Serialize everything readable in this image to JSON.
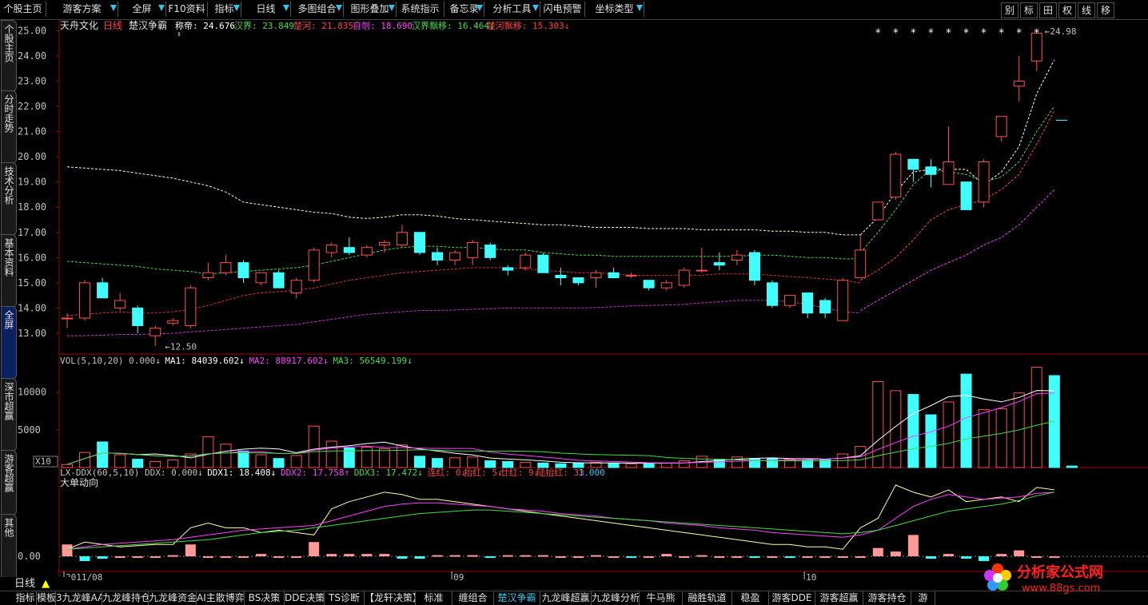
{
  "toolbar": {
    "items": [
      {
        "label": "个股主页",
        "dd": false
      },
      {
        "label": "游客方案",
        "dd": true
      },
      {
        "label": "全屏",
        "dd": true
      },
      {
        "label": "F10资料",
        "dd": false
      },
      {
        "label": "指标",
        "dd": true
      },
      {
        "label": "日线",
        "dd": true
      },
      {
        "label": "多图组合",
        "dd": true
      },
      {
        "label": "图形叠加",
        "dd": true
      },
      {
        "label": "系统指示",
        "dd": false
      },
      {
        "label": "备忘录",
        "dd": true
      },
      {
        "label": "分析工具",
        "dd": true
      },
      {
        "label": "闪电预警",
        "dd": false
      },
      {
        "label": "坐标类型",
        "dd": true
      }
    ],
    "right_buttons": [
      "别",
      "标",
      "田",
      "权",
      "线",
      "移"
    ],
    "logo_text": "分析家公式网"
  },
  "sidebar": {
    "tabs": [
      "个股主页",
      "分时走势",
      "技术分析",
      "基本资料",
      "全屏",
      "深市超赢",
      "游客超赢",
      "其他"
    ]
  },
  "main_chart": {
    "title_stock": "天舟文化",
    "title_period": "日线",
    "indicator_name": "楚汉争霸",
    "legend": [
      {
        "label": "称帝: 24.676",
        "color": "#ffffff"
      },
      {
        "label": "汉界: 23.849",
        "color": "#44dd44"
      },
      {
        "label": "楚河: 21.835",
        "color": "#ff4040"
      },
      {
        "label": "自刎: 18.690",
        "color": "#ff40ff"
      },
      {
        "label": "汉界飘移: 16.464↓",
        "color": "#44dd44"
      },
      {
        "label": "楚河飘移: 15.303↓",
        "color": "#ff4040"
      }
    ],
    "y_ticks": [
      "25.00",
      "24.00",
      "23.00",
      "22.00",
      "21.00",
      "20.00",
      "19.00",
      "18.00",
      "17.00",
      "16.00",
      "15.00",
      "14.00",
      "13.00"
    ],
    "low_label": "12.50",
    "high_label": "24.98"
  },
  "vol_chart": {
    "legend": [
      {
        "label": "VOL(5,10,20) 0.000↓",
        "color": "#c0c0c0"
      },
      {
        "label": "MA1: 84039.602↓",
        "color": "#ffffff"
      },
      {
        "label": "MA2: 88917.602↓",
        "color": "#ff40ff"
      },
      {
        "label": "MA3: 56549.199↓",
        "color": "#44dd44"
      }
    ],
    "y_ticks": [
      "10000",
      "5000"
    ],
    "multiplier": "X10"
  },
  "ddx_chart": {
    "legend": [
      {
        "label": "LX-DDX(60,5,10) DDX: 0.000↓",
        "color": "#c0c0c0"
      },
      {
        "label": "DDX1: 18.408↓",
        "color": "#ffffff"
      },
      {
        "label": "DDX2: 17.758↑",
        "color": "#ff40ff"
      },
      {
        "label": "DDX3: 17.472↓",
        "color": "#44dd44"
      },
      {
        "label": "连红: 0↓",
        "color": "#ff4040"
      },
      {
        "label": "抬红: 5↓",
        "color": "#ff4040"
      },
      {
        "label": "廿红: 9↓",
        "color": "#ff4040"
      },
      {
        "label": "陆抬红: 33",
        "color": "#ff4040"
      },
      {
        "label": "1.000",
        "color": "#37c0e8"
      }
    ],
    "subtitle": "大单动向",
    "y_tick": "0.00"
  },
  "x_axis": {
    "labels": [
      {
        "text": "2011/08",
        "i": 0
      },
      {
        "text": "09",
        "i": 22
      },
      {
        "text": "10",
        "i": 42
      }
    ]
  },
  "period_label": "日线",
  "bottom_tabs": [
    "指标",
    "模板",
    "3九龙峰AAX",
    "九龙峰持仓",
    "九龙峰资金",
    "AI主散博弈",
    "BS决策",
    "DDE决策",
    "TS诊断",
    "【龙轩决策】",
    "标准",
    "缠组合",
    "楚汉争霸",
    "九龙峰超赢",
    "九龙峰分析",
    "牛马熊",
    "融胜轨道",
    "稳盈",
    "游客DDE",
    "游客超赢",
    "游客持仓",
    "游"
  ],
  "active_bottom_tab": "楚汉争霸",
  "brand": {
    "name": "分析家公式网",
    "url": "www.88gs.com"
  },
  "colors": {
    "up": "#ff5050",
    "down": "#40ffff",
    "grid": "#800000",
    "axis": "#a00000"
  },
  "chart_data": {
    "type": "candlestick",
    "candles": [
      {
        "o": 13.6,
        "h": 13.8,
        "l": 13.2,
        "c": 13.6
      },
      {
        "o": 13.6,
        "h": 15.1,
        "l": 13.5,
        "c": 15.0
      },
      {
        "o": 15.0,
        "h": 15.2,
        "l": 14.6,
        "c": 14.4
      },
      {
        "o": 14.0,
        "h": 14.6,
        "l": 13.9,
        "c": 14.3
      },
      {
        "o": 14.0,
        "h": 14.1,
        "l": 13.0,
        "c": 13.3
      },
      {
        "o": 12.9,
        "h": 13.3,
        "l": 12.5,
        "c": 13.2
      },
      {
        "o": 13.4,
        "h": 13.6,
        "l": 13.3,
        "c": 13.5
      },
      {
        "o": 13.3,
        "h": 14.9,
        "l": 13.2,
        "c": 14.8
      },
      {
        "o": 15.2,
        "h": 15.8,
        "l": 15.1,
        "c": 15.4
      },
      {
        "o": 15.4,
        "h": 16.1,
        "l": 15.3,
        "c": 15.8
      },
      {
        "o": 15.8,
        "h": 15.9,
        "l": 15.0,
        "c": 15.2
      },
      {
        "o": 15.0,
        "h": 15.4,
        "l": 14.9,
        "c": 15.4
      },
      {
        "o": 15.4,
        "h": 15.5,
        "l": 14.8,
        "c": 14.8
      },
      {
        "o": 14.6,
        "h": 15.2,
        "l": 14.4,
        "c": 15.1
      },
      {
        "o": 15.1,
        "h": 16.4,
        "l": 15.0,
        "c": 16.3
      },
      {
        "o": 16.2,
        "h": 16.6,
        "l": 16.0,
        "c": 16.5
      },
      {
        "o": 16.4,
        "h": 16.8,
        "l": 16.1,
        "c": 16.2
      },
      {
        "o": 16.1,
        "h": 16.5,
        "l": 16.0,
        "c": 16.4
      },
      {
        "o": 16.5,
        "h": 16.7,
        "l": 16.2,
        "c": 16.6
      },
      {
        "o": 16.5,
        "h": 17.3,
        "l": 16.4,
        "c": 17.0
      },
      {
        "o": 17.0,
        "h": 17.0,
        "l": 16.1,
        "c": 16.2
      },
      {
        "o": 16.2,
        "h": 16.4,
        "l": 15.7,
        "c": 15.9
      },
      {
        "o": 15.9,
        "h": 16.3,
        "l": 15.7,
        "c": 16.2
      },
      {
        "o": 16.0,
        "h": 16.7,
        "l": 15.7,
        "c": 16.6
      },
      {
        "o": 16.5,
        "h": 16.6,
        "l": 15.9,
        "c": 16.0
      },
      {
        "o": 15.6,
        "h": 15.7,
        "l": 15.3,
        "c": 15.5
      },
      {
        "o": 15.6,
        "h": 16.2,
        "l": 15.5,
        "c": 16.1
      },
      {
        "o": 16.1,
        "h": 16.2,
        "l": 15.4,
        "c": 15.4
      },
      {
        "o": 15.3,
        "h": 15.6,
        "l": 14.9,
        "c": 15.2
      },
      {
        "o": 15.2,
        "h": 15.2,
        "l": 14.9,
        "c": 15.0
      },
      {
        "o": 15.2,
        "h": 15.5,
        "l": 14.8,
        "c": 15.4
      },
      {
        "o": 15.4,
        "h": 15.6,
        "l": 15.2,
        "c": 15.2
      },
      {
        "o": 15.3,
        "h": 15.4,
        "l": 15.2,
        "c": 15.3
      },
      {
        "o": 15.1,
        "h": 15.1,
        "l": 14.7,
        "c": 14.8
      },
      {
        "o": 14.8,
        "h": 15.1,
        "l": 14.7,
        "c": 15.0
      },
      {
        "o": 14.9,
        "h": 15.6,
        "l": 14.8,
        "c": 15.5
      },
      {
        "o": 15.5,
        "h": 16.4,
        "l": 15.4,
        "c": 15.5
      },
      {
        "o": 15.8,
        "h": 16.2,
        "l": 15.5,
        "c": 15.7
      },
      {
        "o": 15.9,
        "h": 16.3,
        "l": 15.7,
        "c": 16.1
      },
      {
        "o": 16.2,
        "h": 16.3,
        "l": 14.9,
        "c": 15.1
      },
      {
        "o": 15.0,
        "h": 15.1,
        "l": 14.0,
        "c": 14.1
      },
      {
        "o": 14.1,
        "h": 14.5,
        "l": 14.0,
        "c": 14.5
      },
      {
        "o": 14.6,
        "h": 14.6,
        "l": 13.6,
        "c": 13.8
      },
      {
        "o": 14.3,
        "h": 14.4,
        "l": 13.6,
        "c": 13.8
      },
      {
        "o": 13.5,
        "h": 15.2,
        "l": 13.5,
        "c": 15.1
      },
      {
        "o": 15.2,
        "h": 16.9,
        "l": 15.2,
        "c": 16.3
      },
      {
        "o": 17.5,
        "h": 18.2,
        "l": 17.5,
        "c": 18.2
      },
      {
        "o": 18.4,
        "h": 20.2,
        "l": 18.3,
        "c": 20.1
      },
      {
        "o": 19.9,
        "h": 19.9,
        "l": 19.0,
        "c": 19.5
      },
      {
        "o": 19.6,
        "h": 19.9,
        "l": 18.8,
        "c": 19.3
      },
      {
        "o": 18.9,
        "h": 21.2,
        "l": 18.9,
        "c": 19.8
      },
      {
        "o": 19.0,
        "h": 19.0,
        "l": 17.9,
        "c": 17.9
      },
      {
        "o": 18.2,
        "h": 19.9,
        "l": 18.0,
        "c": 19.8
      },
      {
        "o": 20.8,
        "h": 21.6,
        "l": 20.6,
        "c": 21.6
      },
      {
        "o": 22.8,
        "h": 24.0,
        "l": 22.2,
        "c": 23.0
      },
      {
        "o": 23.8,
        "h": 24.98,
        "l": 23.4,
        "c": 24.9
      }
    ],
    "lines": {
      "white_top": [
        19.6,
        19.55,
        19.5,
        19.45,
        19.35,
        19.25,
        19.15,
        19.0,
        18.85,
        18.6,
        18.2,
        18.1,
        18.0,
        17.9,
        17.8,
        17.75,
        17.6,
        17.55,
        17.6,
        17.7,
        17.7,
        17.65,
        17.55,
        17.5,
        17.45,
        17.4,
        17.35,
        17.3,
        17.3,
        17.25,
        17.2,
        17.2,
        17.2,
        17.15,
        17.15,
        17.15,
        17.1,
        17.1,
        17.1,
        17.1,
        17.05,
        17.05,
        17.0,
        17.0,
        16.9,
        16.9
      ],
      "green_mid": [
        15.85,
        15.8,
        15.75,
        15.7,
        15.65,
        15.55,
        15.5,
        15.45,
        15.35,
        15.4,
        15.45,
        15.5,
        15.55,
        15.6,
        15.7,
        15.85,
        16.0,
        16.15,
        16.3,
        16.4,
        16.45,
        16.45,
        16.4,
        16.4,
        16.35,
        16.3,
        16.3,
        16.2,
        16.15,
        16.1,
        16.1,
        16.05,
        16.05,
        16.05,
        16.05,
        16.05,
        16.05,
        16.05,
        16.05,
        16.1,
        16.1,
        16.05,
        16.0,
        16.0,
        15.95,
        15.95
      ],
      "red_mid": [
        13.7,
        13.75,
        13.8,
        13.85,
        13.8,
        13.8,
        13.85,
        13.95,
        14.1,
        14.3,
        14.5,
        14.6,
        14.65,
        14.7,
        14.8,
        14.95,
        15.1,
        15.2,
        15.3,
        15.4,
        15.45,
        15.5,
        15.55,
        15.6,
        15.6,
        15.6,
        15.55,
        15.5,
        15.45,
        15.4,
        15.4,
        15.35,
        15.3,
        15.3,
        15.3,
        15.3,
        15.3,
        15.35,
        15.35,
        15.35,
        15.3,
        15.25,
        15.2,
        15.15,
        15.1,
        15.0
      ],
      "magenta_low": [
        12.9,
        12.9,
        12.92,
        12.95,
        12.95,
        12.97,
        13.0,
        13.05,
        13.1,
        13.15,
        13.2,
        13.25,
        13.3,
        13.35,
        13.45,
        13.55,
        13.65,
        13.75,
        13.8,
        13.85,
        13.9,
        13.9,
        13.92,
        13.95,
        13.97,
        14.0,
        14.0,
        14.0,
        14.0,
        14.0,
        14.02,
        14.05,
        14.08,
        14.1,
        14.12,
        14.15,
        14.2,
        14.25,
        14.3,
        14.3,
        14.3,
        14.25,
        14.15,
        14.0,
        13.85,
        13.8
      ],
      "tail_white": [
        16.9,
        17.6,
        18.6,
        19.4,
        19.5,
        19.5,
        19.5,
        18.9,
        19.4,
        20.4,
        22.5,
        23.85
      ],
      "tail_green": [
        16.2,
        17.0,
        17.9,
        18.9,
        19.5,
        19.4,
        19.3,
        19.0,
        19.2,
        19.8,
        21.0,
        22.0
      ],
      "tail_red": [
        15.1,
        15.5,
        16.0,
        16.7,
        17.5,
        17.9,
        18.1,
        18.3,
        18.7,
        19.3,
        20.5,
        21.83
      ],
      "tail_magenta": [
        13.9,
        14.3,
        14.7,
        15.1,
        15.5,
        15.8,
        16.1,
        16.5,
        16.8,
        17.3,
        18.0,
        18.69
      ]
    },
    "volumes": [
      400,
      2000,
      3400,
      1700,
      1100,
      800,
      1000,
      1800,
      4100,
      3100,
      2200,
      1700,
      1200,
      1600,
      5500,
      3500,
      2600,
      2700,
      2500,
      3000,
      1500,
      1200,
      1300,
      1400,
      900,
      800,
      700,
      600,
      500,
      600,
      700,
      600,
      500,
      500,
      600,
      900,
      1500,
      1100,
      1400,
      1200,
      1200,
      1100,
      1000,
      1100,
      1800,
      2800,
      11400,
      10200,
      9700,
      7000,
      8700,
      12400,
      7700,
      7800,
      9900,
      13300,
      12200,
      200
    ]
  }
}
